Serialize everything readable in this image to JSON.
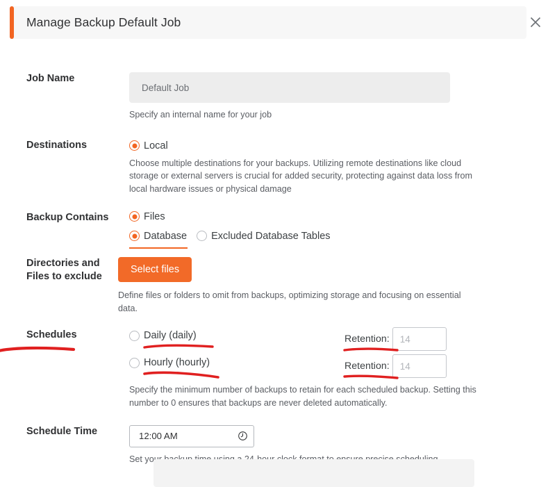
{
  "header": {
    "title": "Manage Backup Default Job",
    "close_icon": "close-icon",
    "accent_color": "#f26522"
  },
  "theme": {
    "accent": "#f26522",
    "button": "#f26a28",
    "annotation": "#e02020"
  },
  "fields": {
    "job_name": {
      "label": "Job Name",
      "value": "Default Job",
      "help": "Specify an internal name for your job",
      "disabled": true
    },
    "destinations": {
      "label": "Destinations",
      "options": [
        {
          "label": "Local",
          "checked": true
        }
      ],
      "help": "Choose multiple destinations for your backups. Utilizing remote destinations like cloud storage or external servers is crucial for added security, protecting against data loss from local hardware issues or physical damage"
    },
    "backup_contains": {
      "label": "Backup Contains",
      "options": [
        {
          "label": "Files",
          "checked": true
        },
        {
          "label": "Database",
          "checked": true
        },
        {
          "label": "Excluded Database Tables",
          "checked": false
        }
      ]
    },
    "exclude": {
      "label": "Directories and Files to exclude",
      "button_label": "Select files",
      "help": "Define files or folders to omit from backups, optimizing storage and focusing on essential data."
    },
    "schedules": {
      "label": "Schedules",
      "rows": [
        {
          "option_label": "Daily (daily)",
          "checked": false,
          "retention_label": "Retention:",
          "retention_value": "",
          "retention_placeholder": "14"
        },
        {
          "option_label": "Hourly (hourly)",
          "checked": false,
          "retention_label": "Retention:",
          "retention_value": "",
          "retention_placeholder": "14"
        }
      ],
      "help": "Specify the minimum number of backups to retain for each scheduled backup. Setting this number to 0 ensures that backups are never deleted automatically."
    },
    "schedule_time": {
      "label": "Schedule Time",
      "value": "12:00 AM",
      "icon": "clock-icon",
      "help": "Set your backup time using a 24-hour clock format to ensure precise scheduling."
    }
  },
  "annotations": [
    {
      "target": "schedules-label",
      "color": "#e02020"
    },
    {
      "target": "daily-option",
      "color": "#e02020"
    },
    {
      "target": "hourly-option",
      "color": "#e02020"
    },
    {
      "target": "retention-label-daily",
      "color": "#e02020"
    },
    {
      "target": "retention-label-hourly",
      "color": "#e02020"
    }
  ]
}
